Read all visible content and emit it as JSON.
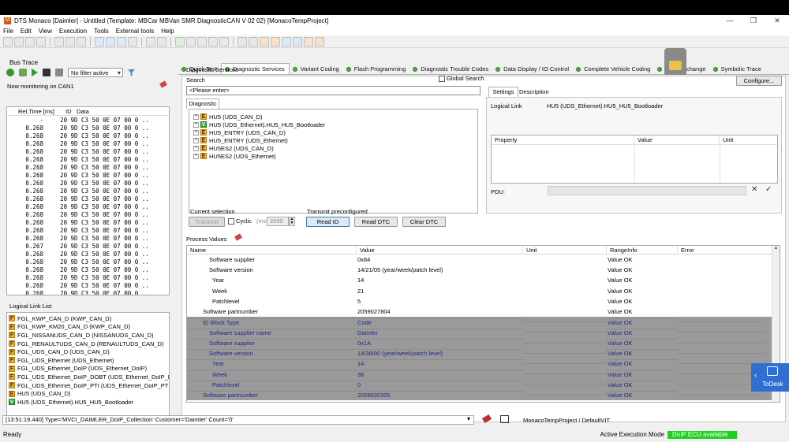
{
  "window": {
    "title": "DTS Monaco [Daimler] - Untitled (Template: MBCar MBVan SMR DiagnosticCAN V 02 02) [MonacoTempProject]",
    "controls": [
      "—",
      "❐",
      "✕"
    ]
  },
  "menu": [
    "File",
    "Edit",
    "View",
    "Execution",
    "Tools",
    "External tools",
    "Help"
  ],
  "bus_trace": {
    "title": "Bus Trace",
    "filter": "No filter active",
    "monitoring": "Now monitoring on CAN1",
    "columns": [
      "Rel.Time [ms]",
      "ID",
      "Data"
    ],
    "rows": [
      {
        "time": "-",
        "id": "20",
        "data": "9D C3 50 0E 07 00 0 .."
      },
      {
        "time": "0.268",
        "id": "20",
        "data": "9D C3 50 0E 07 00 0 .."
      },
      {
        "time": "0.268",
        "id": "20",
        "data": "9D C3 50 0E 07 00 0 .."
      },
      {
        "time": "0.268",
        "id": "20",
        "data": "9D C3 50 0E 07 00 0 .."
      },
      {
        "time": "0.268",
        "id": "20",
        "data": "9D C3 50 0E 07 00 0 .."
      },
      {
        "time": "0.268",
        "id": "20",
        "data": "9D C3 50 0E 07 00 0 .."
      },
      {
        "time": "0.268",
        "id": "20",
        "data": "9D C3 50 0E 07 00 0 .."
      },
      {
        "time": "0.268",
        "id": "20",
        "data": "9D C3 50 0E 07 00 0 .."
      },
      {
        "time": "0.268",
        "id": "20",
        "data": "9D C3 50 0E 07 00 0 .."
      },
      {
        "time": "0.268",
        "id": "20",
        "data": "9D C3 50 0E 07 00 0 .."
      },
      {
        "time": "0.268",
        "id": "20",
        "data": "9D C3 50 0E 07 00 0 .."
      },
      {
        "time": "0.268",
        "id": "20",
        "data": "9D C3 50 0E 07 00 0 .."
      },
      {
        "time": "0.268",
        "id": "20",
        "data": "9D C3 50 0E 07 00 0 .."
      },
      {
        "time": "0.268",
        "id": "20",
        "data": "9D C3 50 0E 07 00 0 .."
      },
      {
        "time": "0.268",
        "id": "20",
        "data": "9D C3 50 0E 07 00 0 .."
      },
      {
        "time": "0.268",
        "id": "20",
        "data": "9D C3 50 0E 07 00 0 .."
      },
      {
        "time": "0.267",
        "id": "20",
        "data": "9D C3 50 0E 07 00 0 .."
      },
      {
        "time": "0.268",
        "id": "20",
        "data": "9D C3 50 0E 07 00 0 .."
      },
      {
        "time": "0.268",
        "id": "20",
        "data": "9D C3 50 0E 07 00 0 .."
      },
      {
        "time": "0.268",
        "id": "20",
        "data": "9D C3 50 0E 07 00 0 .."
      },
      {
        "time": "0.268",
        "id": "20",
        "data": "9D C3 50 0E 07 00 0 .."
      },
      {
        "time": "0.268",
        "id": "20",
        "data": "9D C3 50 0E 07 00 0 .."
      },
      {
        "time": "0.268",
        "id": "20",
        "data": "9D C3 50 0E 07 00 0 .."
      },
      {
        "time": "0.268",
        "id": "20",
        "data": "9D C3 50 0E 07 00 0 .."
      }
    ]
  },
  "logical_links": {
    "title": "Logical Link List",
    "items": [
      {
        "badge": "F",
        "label": "FGL_KWP_CAN_D (KWP_CAN_D)"
      },
      {
        "badge": "F",
        "label": "FGL_KWP_KM20_CAN_D (KWP_CAN_D)"
      },
      {
        "badge": "F",
        "label": "FGL_NISSANUDS_CAN_D (NISSANUDS_CAN_D)"
      },
      {
        "badge": "F",
        "label": "FGL_RENAULTUDS_CAN_D (RENAULTUDS_CAN_D)"
      },
      {
        "badge": "F",
        "label": "FGL_UDS_CAN_D (UDS_CAN_D)"
      },
      {
        "badge": "F",
        "label": "FGL_UDS_Ethernet (UDS_Ethernet)"
      },
      {
        "badge": "F",
        "label": "FGL_UDS_Ethernet_DoIP (UDS_Ethernet_DoIP)"
      },
      {
        "badge": "F",
        "label": "FGL_UDS_Ethernet_DoIP_DOBT (UDS_Ethernet_DoIP_DOBT)"
      },
      {
        "badge": "F",
        "label": "FGL_UDS_Ethernet_DoIP_PTI (UDS_Ethernet_DoIP_PTI)"
      },
      {
        "badge": "E",
        "label": "HU5 (UDS_CAN_D)"
      },
      {
        "badge": "V",
        "label": "HU5 (UDS_Ethernet).HU5_HU5_Bootloader"
      }
    ]
  },
  "tabs": [
    "Quick Test",
    "Diagnostic Services",
    "Variant Coding",
    "Flash Programming",
    "Diagnostic Trouble Codes",
    "Data Display / IO Control",
    "Complete Vehicle Coding",
    "ECU Exchange",
    "Symbolic Trace"
  ],
  "diag_services": {
    "group_title": "Diagnostic Services",
    "search_label": "Search",
    "global_search": "Global Search",
    "search_placeholder": "<Please enter>",
    "diag_tab": "Diagnostic",
    "tree": [
      {
        "badge": "E",
        "label": "HU5 (UDS_CAN_D)"
      },
      {
        "badge": "V",
        "label": "HU5 (UDS_Ethernet).HU5_HU5_Bootloader"
      },
      {
        "badge": "E",
        "label": "HU5_ENTRY (UDS_CAN_D)"
      },
      {
        "badge": "E",
        "label": "HU5_ENTRY (UDS_Ethernet)"
      },
      {
        "badge": "E",
        "label": "HU5ES2 (UDS_CAN_D)"
      },
      {
        "badge": "E",
        "label": "HU5ES2 (UDS_Ethernet)"
      }
    ],
    "configure": "Configure...",
    "settings_tab": "Settings",
    "description_tab": "Description",
    "logical_link_label": "Logical Link",
    "logical_link_value": "HU5 (UDS_Ethernet).HU5_HU5_Bootloader",
    "prop_cols": [
      "Property",
      "Value",
      "Unit"
    ],
    "pdu_label": "PDU:",
    "current_selection": "Current selection",
    "transmit": "Transmit",
    "cyclic": "Cyclic",
    "ms": "(ms)",
    "cyclic_value": "2000",
    "transmit_preconf": "Transmit preconfigured",
    "read_id": "Read ID",
    "read_dtc": "Read DTC",
    "clear_dtc": "Clear DTC"
  },
  "process_values": {
    "title": "Process Values",
    "columns": [
      "Name",
      "Value",
      "Unit",
      "RangeInfo",
      "Error"
    ],
    "rows": [
      {
        "name": "Software supplier",
        "indent": 2,
        "value": "0x84",
        "unit": "",
        "range": "Value OK",
        "error": "",
        "selected": false
      },
      {
        "name": "Software version",
        "indent": 2,
        "value": "14/21/05 (year/week/patch level)",
        "unit": "",
        "range": "Value OK",
        "error": "",
        "selected": false
      },
      {
        "name": "Year",
        "indent": 3,
        "value": "14",
        "unit": "",
        "range": "Value OK",
        "error": "",
        "selected": false
      },
      {
        "name": "Week",
        "indent": 3,
        "value": "21",
        "unit": "",
        "range": "Value OK",
        "error": "",
        "selected": false
      },
      {
        "name": "Patchlevel",
        "indent": 3,
        "value": "5",
        "unit": "",
        "range": "Value OK",
        "error": "",
        "selected": false
      },
      {
        "name": "Software partnumber",
        "indent": 1,
        "value": "2059027804",
        "unit": "",
        "range": "Value OK",
        "error": "",
        "selected": false
      },
      {
        "name": "ID Block Type",
        "indent": 0,
        "value": "Code",
        "unit": "",
        "range": "Value OK",
        "error": "",
        "selected": true
      },
      {
        "name": "Software supplier name",
        "indent": 2,
        "value": "Daimler",
        "unit": "",
        "range": "Value OK",
        "error": "",
        "selected": true
      },
      {
        "name": "Software supplier",
        "indent": 2,
        "value": "0x1A",
        "unit": "",
        "range": "Value OK",
        "error": "",
        "selected": true
      },
      {
        "name": "Software version",
        "indent": 2,
        "value": "14/38/00 (year/week/patch level)",
        "unit": "",
        "range": "Value OK",
        "error": "",
        "selected": true
      },
      {
        "name": "Year",
        "indent": 3,
        "value": "14",
        "unit": "",
        "range": "Value OK",
        "error": "",
        "selected": true
      },
      {
        "name": "Week",
        "indent": 3,
        "value": "38",
        "unit": "",
        "range": "Value OK",
        "error": "",
        "selected": true
      },
      {
        "name": "Patchlevel",
        "indent": 3,
        "value": "0",
        "unit": "",
        "range": "Value OK",
        "error": "",
        "selected": true
      },
      {
        "name": "Software partnumber",
        "indent": 1,
        "value": "2059020305",
        "unit": "",
        "range": "Value OK",
        "error": "",
        "selected": true
      }
    ]
  },
  "status_line": "[13:51:19.440] Type='MVCI_DAIMLER_DoIP_Collection' Customer='Daimler' Count='0'",
  "project_path": "MonacoTempProject / DefaultVIT",
  "status": {
    "ready": "Ready",
    "mode_label": "Active Execution Mode",
    "mode_value": "DoIP ECU available"
  },
  "todesk": "ToDesk",
  "colors": {
    "selected_row": "#9a9a9a",
    "selected_text": "#1f2a88",
    "status_green": "#20d020",
    "todesk_blue": "#2f6fd2"
  }
}
